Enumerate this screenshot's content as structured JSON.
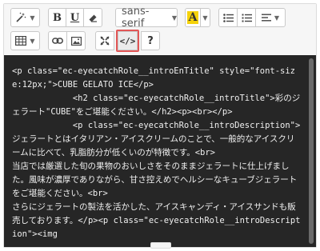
{
  "toolbar": {
    "style_icon": "magic-wand-icon",
    "bold_label": "B",
    "underline_label": "U",
    "eraser_icon": "eraser-icon",
    "font_family_value": "sans-serif",
    "color_label": "A",
    "color_accent": "#f5d20a",
    "unordered_list_icon": "unordered-list-icon",
    "ordered_list_icon": "ordered-list-icon",
    "paragraph_icon": "align-left-icon",
    "table_icon": "table-icon",
    "link_icon": "link-icon",
    "picture_icon": "picture-icon",
    "fullscreen_icon": "fullscreen-icon",
    "codeview_label": "</>",
    "help_label": "?",
    "highlight_color": "#e25656"
  },
  "editor": {
    "code": "<p class=\"ec-eyecatchRole__introEnTitle\" style=\"font-size:12px;\">CUBE GELATO ICE</p>\n            <h2 class=\"ec-eyecatchRole__introTitle\">彩のジェラート\"CUBE\"をご堪能ください。</h2><p><br></p>\n            <p class=\"ec-eyecatchRole__introDescription\">ジェラートとはイタリアン・アイスクリームのことで、一般的なアイスクリームに比べて、乳脂肪分が低くいのが特徴です。<br>\n当店では厳選した旬の果物のおいしさをそのままジェラートに仕上げました。風味が濃厚でありながら、甘さ控えめでヘルシーなキューブジェラートをご堪能ください。<br>\nさらにジェラートの製法を活かした、アイスキャンディ・アイスサンドも販売しております。</p><p class=\"ec-eyecatchRole__introDescription\"><img",
    "background": "#262626",
    "text_color": "#f0f0f0"
  }
}
